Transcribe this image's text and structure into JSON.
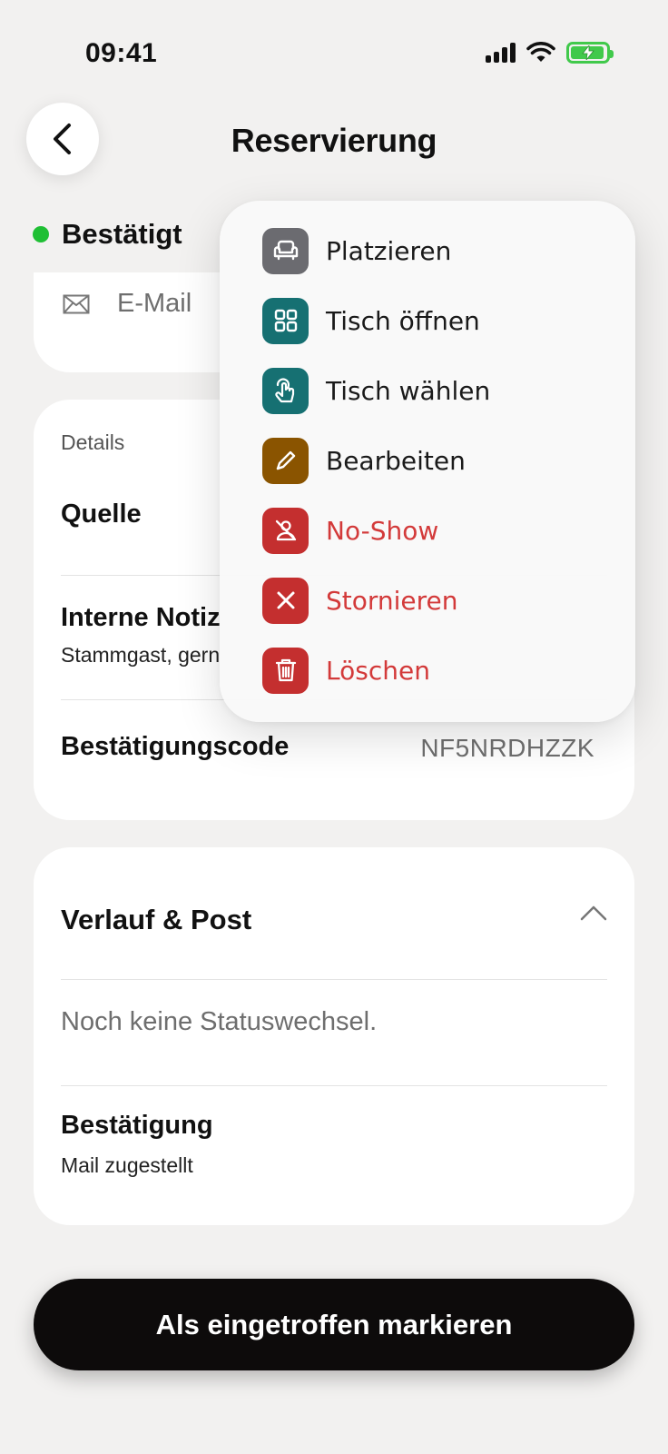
{
  "status_bar": {
    "time": "09:41"
  },
  "header": {
    "title": "Reservierung"
  },
  "reservation": {
    "status": "Bestätigt",
    "status_color": "#1fbf34"
  },
  "contact": {
    "email_label": "E-Mail"
  },
  "details": {
    "section_label": "Details",
    "source_label": "Quelle",
    "note_label": "Interne Notiz",
    "note_value": "Stammgast, gern",
    "code_label": "Bestätigungscode",
    "code_value": "NF5NRDHZZK"
  },
  "history": {
    "title": "Verlauf & Post",
    "empty_text": "Noch keine Statuswechsel.",
    "confirmation_label": "Bestätigung",
    "confirmation_status": "Mail zugestellt"
  },
  "primary_action": {
    "label": "Als eingetroffen markieren"
  },
  "context_menu": {
    "items": [
      {
        "label": "Platzieren",
        "icon": "armchair-icon",
        "color": "#6b6b70"
      },
      {
        "label": "Tisch öffnen",
        "icon": "grid-icon",
        "color": "#167072"
      },
      {
        "label": "Tisch wählen",
        "icon": "tap-icon",
        "color": "#167072"
      },
      {
        "label": "Bearbeiten",
        "icon": "pencil-icon",
        "color": "#8a5400"
      },
      {
        "label": "No-Show",
        "icon": "no-person-icon",
        "color": "#c42f2f"
      },
      {
        "label": "Stornieren",
        "icon": "x-icon",
        "color": "#c42f2f"
      },
      {
        "label": "Löschen",
        "icon": "trash-icon",
        "color": "#c42f2f"
      }
    ]
  }
}
